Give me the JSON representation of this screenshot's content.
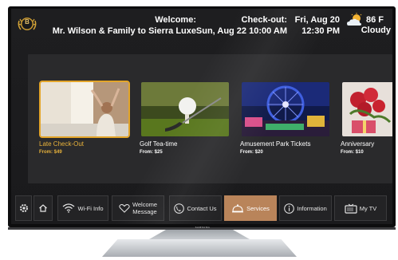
{
  "header": {
    "welcome_line1": "Welcome:",
    "welcome_line2": "Mr. Wilson & Family to Sierra Luxe",
    "checkout_line1": "Check-out:",
    "checkout_line2": "Sun, Aug 22 10:00 AM",
    "date": "Fri, Aug 20",
    "time": "12:30 PM",
    "temperature": "86 F",
    "condition": "Cloudy",
    "logo_letter": "B"
  },
  "services": [
    {
      "title": "Late Check-Out",
      "price": "From: $49",
      "image": "woman-stretching-by-window",
      "selected": true
    },
    {
      "title": "Golf Tea-time",
      "price": "From: $25",
      "image": "golf-ball-on-tee",
      "selected": false
    },
    {
      "title": "Amusement Park Tickets",
      "price": "From: $20",
      "image": "ferris-wheel-night",
      "selected": false
    },
    {
      "title": "Anniversary",
      "price": "From: $10",
      "image": "roses-and-gifts",
      "selected": false
    }
  ],
  "nav": {
    "wifi": "Wi-Fi Info",
    "welcome_msg_1": "Welcome",
    "welcome_msg_2": "Message",
    "contact": "Contact Us",
    "services": "Services",
    "information": "Information",
    "mytv": "My TV"
  },
  "tv_brand": "SAMSUNG",
  "colors": {
    "accent_gold": "#e8b23b",
    "active_nav": "#b9845a",
    "panel": "#2a2a2c"
  }
}
